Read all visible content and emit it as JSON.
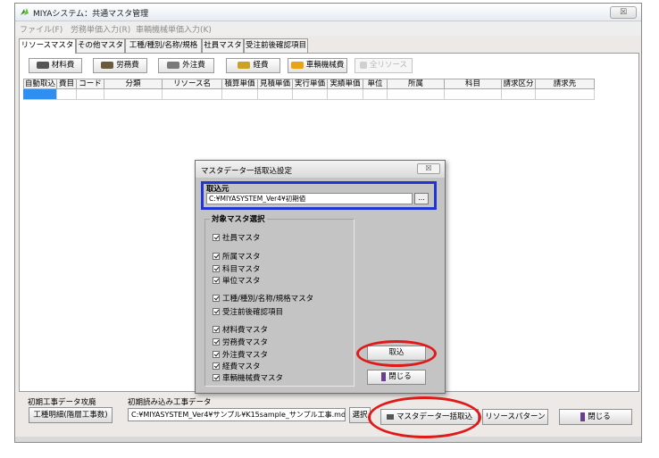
{
  "window": {
    "title": "MIYAシステム：共通マスタ管理",
    "close_glyph": "☒"
  },
  "menu": [
    "ファイル(F)",
    "労務単価入力(R)",
    "車輌機械単価入力(K)"
  ],
  "tabs": [
    "リソースマスタ",
    "その他マスタ",
    "工種/種別/名称/規格",
    "社員マスタ",
    "受注前後確認項目"
  ],
  "toolbar": [
    "材料費",
    "労務費",
    "外注費",
    "経費",
    "車輌機械費",
    "全リソース"
  ],
  "grid": {
    "columns": [
      "自動取込",
      "費目",
      "コード",
      "分類",
      "リソース名",
      "積算単価",
      "見積単価",
      "実行単価",
      "実績単価",
      "単位",
      "所属",
      "科目",
      "請求区分",
      "請求先"
    ]
  },
  "bottom": {
    "initial_data_label": "初期工事データ攻廃",
    "initial_data_button": "工種明細(階層工事数)",
    "load_label": "初期読み込み工事データ",
    "path": "C:¥MIYASYSTEM_Ver4¥サンプル¥K15sample_サンプル工事.mdb",
    "select_button": "選択",
    "bulk_import_button": "マスタデータ一括取込",
    "resource_pattern_button": "リソースパターン",
    "close_button": "閉じる"
  },
  "dialog": {
    "title": "マスタデータ一括取込設定",
    "close_glyph": "☒",
    "source_label": "取込元",
    "source_path": "C:¥MIYASYSTEM_Ver4¥初期値",
    "browse_button": "...",
    "target_group_label": "対象マスタ選択",
    "checkboxes": [
      "社員マスタ",
      "所属マスタ",
      "科目マスタ",
      "単位マスタ",
      "工種/種別/名称/規格マスタ",
      "受注前後確認項目",
      "材料費マスタ",
      "労務費マスタ",
      "外注費マスタ",
      "経費マスタ",
      "車輌機械費マスタ"
    ],
    "import_button": "取込",
    "close_button": "閉じる"
  },
  "colors": {
    "highlight_box": "#1f35d6",
    "ellipse": "#e01919",
    "selection": "#2f8ff0"
  }
}
